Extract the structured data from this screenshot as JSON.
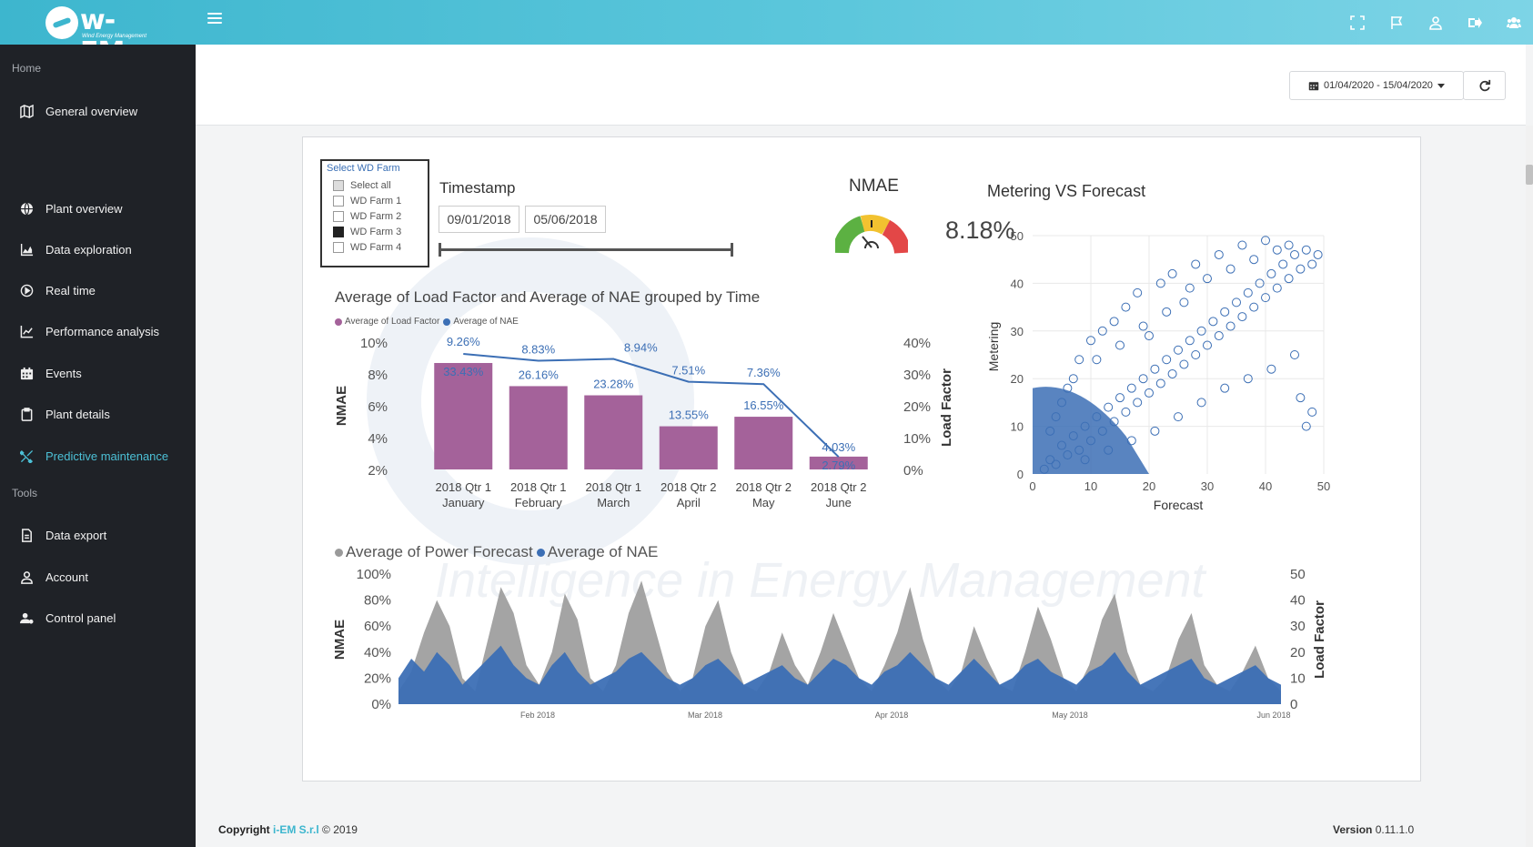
{
  "app": {
    "brand": "w-EM",
    "brand_sub": "Wind Energy Management",
    "top_icons": [
      "expand-icon",
      "flag-icon",
      "user-icon",
      "logout-icon",
      "users-icon"
    ]
  },
  "sidebar": {
    "section_home": "Home",
    "section_tools": "Tools",
    "items": [
      {
        "label": "General overview",
        "icon": "map-icon"
      },
      {
        "label": "Plant overview",
        "icon": "globe-icon"
      },
      {
        "label": "Data exploration",
        "icon": "area-chart-icon"
      },
      {
        "label": "Real time",
        "icon": "play-circle-icon"
      },
      {
        "label": "Performance analysis",
        "icon": "line-chart-icon"
      },
      {
        "label": "Events",
        "icon": "calendar-icon"
      },
      {
        "label": "Plant details",
        "icon": "clipboard-icon"
      },
      {
        "label": "Predictive maintenance",
        "icon": "tools-icon",
        "active": true
      }
    ],
    "tool_items": [
      {
        "label": "Data export",
        "icon": "file-icon"
      },
      {
        "label": "Account",
        "icon": "user-icon"
      },
      {
        "label": "Control panel",
        "icon": "users-cog-icon"
      }
    ],
    "active_color": "#4cc0d6"
  },
  "toolbar": {
    "date_range": "01/04/2020 - 15/04/2020",
    "refresh_icon": "refresh-icon"
  },
  "report": {
    "watermark_text": "Intelligence in Energy Management",
    "slicer": {
      "title": "Select WD Farm",
      "options": [
        {
          "label": "Select all",
          "state": "partial"
        },
        {
          "label": "WD Farm 1",
          "state": "unchecked"
        },
        {
          "label": "WD Farm 2",
          "state": "unchecked"
        },
        {
          "label": "WD Farm 3",
          "state": "checked"
        },
        {
          "label": "WD Farm 4",
          "state": "unchecked"
        }
      ]
    },
    "timestamp": {
      "title": "Timestamp",
      "start": "09/01/2018",
      "end": "05/06/2018"
    },
    "nmae": {
      "title": "NMAE",
      "value": "8.18%"
    }
  },
  "chart_data": [
    {
      "type": "bar",
      "title": "Average of Load Factor and Average of NAE grouped by Time",
      "legend": [
        "Average of Load Factor",
        "Average of NAE"
      ],
      "legend_position": "top-left",
      "ylabel_left": "NMAE",
      "ylabel_right": "Load Factor",
      "left_ticks": [
        "10%",
        "8%",
        "6%",
        "4%",
        "2%"
      ],
      "right_ticks": [
        "40%",
        "30%",
        "20%",
        "10%",
        "0%"
      ],
      "categories": [
        [
          "2018 Qtr 1",
          "January"
        ],
        [
          "2018 Qtr 1",
          "February"
        ],
        [
          "2018 Qtr 1",
          "March"
        ],
        [
          "2018 Qtr 2",
          "April"
        ],
        [
          "2018 Qtr 2",
          "May"
        ],
        [
          "2018 Qtr 2",
          "June"
        ]
      ],
      "series": [
        {
          "name": "Average of Load Factor",
          "color": "#a4629a",
          "values": [
            33.43,
            26.16,
            23.28,
            13.55,
            16.55,
            4.03
          ],
          "labels": [
            "33.43%",
            "26.16%",
            "23.28%",
            "13.55%",
            "16.55%",
            "4.03%"
          ]
        },
        {
          "name": "Average of NAE",
          "color": "#3c6fb5",
          "values": [
            9.26,
            8.83,
            8.94,
            7.51,
            7.36,
            2.79
          ],
          "labels": [
            "9.26%",
            "8.83%",
            "8.94%",
            "7.51%",
            "7.36%",
            "2.79%"
          ]
        }
      ],
      "ylim_left": [
        2,
        10
      ],
      "ylim_right": [
        0,
        40
      ]
    },
    {
      "type": "scatter",
      "title": "Metering VS Forecast",
      "xlabel": "Forecast",
      "ylabel": "Metering",
      "xlim": [
        0,
        50
      ],
      "ylim": [
        0,
        50
      ],
      "x_ticks": [
        "0",
        "10",
        "20",
        "30",
        "40",
        "50"
      ],
      "y_ticks": [
        "0",
        "10",
        "20",
        "30",
        "40",
        "50"
      ],
      "grid": true,
      "color": "#3c6fb5",
      "points": [
        [
          2,
          1
        ],
        [
          3,
          3
        ],
        [
          4,
          2
        ],
        [
          5,
          6
        ],
        [
          6,
          4
        ],
        [
          7,
          8
        ],
        [
          8,
          5
        ],
        [
          9,
          10
        ],
        [
          10,
          7
        ],
        [
          11,
          12
        ],
        [
          12,
          9
        ],
        [
          13,
          14
        ],
        [
          14,
          11
        ],
        [
          15,
          16
        ],
        [
          16,
          13
        ],
        [
          17,
          18
        ],
        [
          18,
          15
        ],
        [
          19,
          20
        ],
        [
          20,
          17
        ],
        [
          21,
          22
        ],
        [
          22,
          19
        ],
        [
          23,
          24
        ],
        [
          24,
          21
        ],
        [
          25,
          26
        ],
        [
          26,
          23
        ],
        [
          27,
          28
        ],
        [
          28,
          25
        ],
        [
          29,
          30
        ],
        [
          30,
          27
        ],
        [
          31,
          32
        ],
        [
          32,
          29
        ],
        [
          33,
          34
        ],
        [
          34,
          31
        ],
        [
          35,
          36
        ],
        [
          36,
          33
        ],
        [
          37,
          38
        ],
        [
          38,
          35
        ],
        [
          39,
          40
        ],
        [
          40,
          37
        ],
        [
          41,
          42
        ],
        [
          42,
          39
        ],
        [
          43,
          44
        ],
        [
          44,
          41
        ],
        [
          45,
          46
        ],
        [
          46,
          43
        ],
        [
          47,
          47
        ],
        [
          48,
          44
        ],
        [
          49,
          46
        ],
        [
          4,
          12
        ],
        [
          6,
          18
        ],
        [
          8,
          24
        ],
        [
          10,
          28
        ],
        [
          12,
          30
        ],
        [
          14,
          32
        ],
        [
          16,
          35
        ],
        [
          18,
          38
        ],
        [
          22,
          40
        ],
        [
          24,
          42
        ],
        [
          9,
          3
        ],
        [
          13,
          5
        ],
        [
          17,
          7
        ],
        [
          21,
          9
        ],
        [
          25,
          12
        ],
        [
          29,
          15
        ],
        [
          33,
          18
        ],
        [
          37,
          20
        ],
        [
          41,
          22
        ],
        [
          45,
          25
        ],
        [
          47,
          10
        ],
        [
          48,
          13
        ],
        [
          46,
          16
        ],
        [
          20,
          29
        ],
        [
          26,
          36
        ],
        [
          28,
          44
        ],
        [
          32,
          46
        ],
        [
          36,
          48
        ],
        [
          40,
          49
        ],
        [
          44,
          48
        ],
        [
          42,
          47
        ],
        [
          38,
          45
        ],
        [
          34,
          43
        ],
        [
          30,
          41
        ],
        [
          27,
          39
        ],
        [
          23,
          34
        ],
        [
          19,
          31
        ],
        [
          15,
          27
        ],
        [
          11,
          24
        ],
        [
          7,
          20
        ],
        [
          5,
          15
        ],
        [
          3,
          9
        ]
      ]
    },
    {
      "type": "area",
      "legend": [
        "Average of Power Forecast",
        "Average of NAE"
      ],
      "legend_position": "top-left",
      "ylabel_left": "NMAE",
      "ylabel_right": "Load Factor",
      "left_ticks": [
        "100%",
        "80%",
        "60%",
        "40%",
        "20%",
        "0%"
      ],
      "right_ticks": [
        "50",
        "40",
        "30",
        "20",
        "10",
        "0"
      ],
      "x_ticks": [
        "Feb 2018",
        "Mar 2018",
        "Apr 2018",
        "May 2018",
        "Jun 2018"
      ],
      "series": [
        {
          "name": "Average of Power Forecast",
          "color": "#9a9a9a",
          "values": [
            10,
            25,
            55,
            80,
            60,
            20,
            10,
            50,
            90,
            70,
            30,
            15,
            40,
            85,
            65,
            20,
            10,
            30,
            70,
            95,
            60,
            25,
            10,
            20,
            60,
            80,
            40,
            15,
            10,
            25,
            55,
            30,
            15,
            40,
            70,
            45,
            20,
            10,
            30,
            55,
            90,
            50,
            20,
            10,
            25,
            60,
            35,
            15,
            10,
            40,
            75,
            50,
            20,
            10,
            30,
            65,
            85,
            40,
            15,
            10,
            20,
            50,
            70,
            30,
            15,
            10,
            25,
            45,
            20,
            10
          ]
        },
        {
          "name": "Average of NAE",
          "color": "#3c6fb5",
          "values": [
            20,
            35,
            25,
            40,
            30,
            15,
            25,
            35,
            45,
            30,
            20,
            15,
            30,
            40,
            25,
            15,
            20,
            25,
            35,
            40,
            30,
            20,
            15,
            20,
            30,
            35,
            25,
            15,
            20,
            25,
            30,
            20,
            15,
            25,
            35,
            30,
            20,
            15,
            25,
            30,
            40,
            30,
            20,
            15,
            25,
            35,
            25,
            15,
            20,
            30,
            35,
            25,
            20,
            15,
            25,
            30,
            40,
            25,
            15,
            20,
            25,
            30,
            35,
            20,
            15,
            20,
            25,
            30,
            20,
            15
          ]
        }
      ],
      "ylim_left": [
        0,
        100
      ],
      "ylim_right": [
        0,
        50
      ]
    }
  ],
  "footer": {
    "copyright_prefix": "Copyright",
    "company": "i-EM S.r.l",
    "year": "© 2019",
    "version_label": "Version",
    "version": "0.11.1.0"
  }
}
